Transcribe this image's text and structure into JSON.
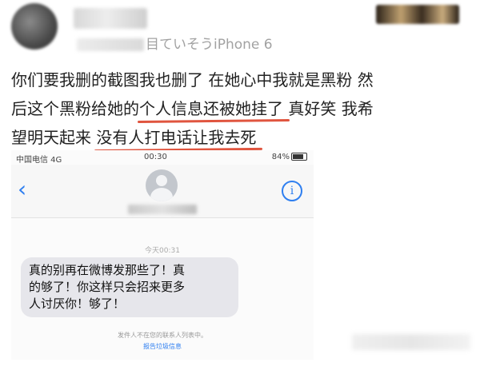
{
  "post": {
    "source_suffix": "目ていそうiPhone 6",
    "content_lines": [
      {
        "plain": "你们要我删的截图我也删了  在她心中我就是黑粉  然"
      },
      {
        "before": "后这个黑粉给她的",
        "underlined": "个人信息还被她挂了",
        "after": "  真好笑  我希"
      },
      {
        "before": "望明天起来 ",
        "underlined": "没有人打电话让我去死",
        "after": ""
      }
    ]
  },
  "screenshot": {
    "status": {
      "carrier": "中国电信  4G",
      "time": "00:30",
      "battery": "84%"
    },
    "nav": {
      "back_icon": "‹",
      "info_icon": "i"
    },
    "timestamp": "今天00:31",
    "message_lines": [
      "真的别再在微博发那些了！真",
      "的够了！你这样只会招来更多",
      "人讨厌你！够了！"
    ],
    "notice": "发件人不在您的联系人列表中。",
    "report_link": "报告垃圾信息"
  },
  "colors": {
    "underline": "#e0553f",
    "ios_blue": "#2f7ff0",
    "bubble": "#e6e6eb"
  }
}
